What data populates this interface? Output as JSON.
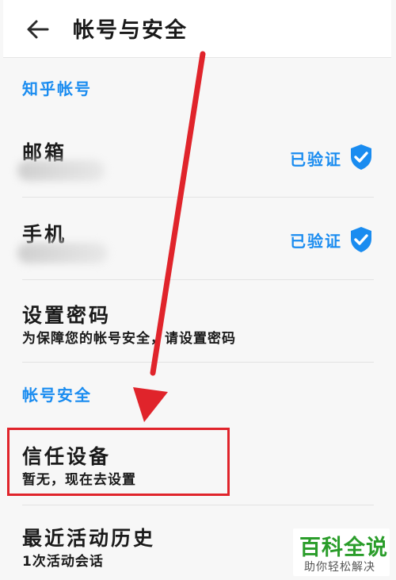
{
  "header": {
    "title": "帐号与安全",
    "back_icon": "arrow-left-icon"
  },
  "sections": {
    "account": {
      "label": "知乎帐号"
    },
    "security": {
      "label": "帐号安全"
    }
  },
  "rows": {
    "email": {
      "title": "邮箱",
      "status": "已验证"
    },
    "phone": {
      "title": "手机",
      "status": "已验证"
    },
    "password": {
      "title": "设置密码",
      "subtitle": "为保障您的帐号安全，请设置密码"
    },
    "trusted_devices": {
      "title": "信任设备",
      "subtitle": "暂无，现在去设置"
    },
    "recent_activity": {
      "title": "最近活动历史",
      "subtitle": "1次活动会话"
    }
  },
  "colors": {
    "accent": "#1a8cf0",
    "annotation_red": "#e0242b"
  },
  "watermark": {
    "main": "百科全说",
    "sub": "助你轻松解决"
  }
}
